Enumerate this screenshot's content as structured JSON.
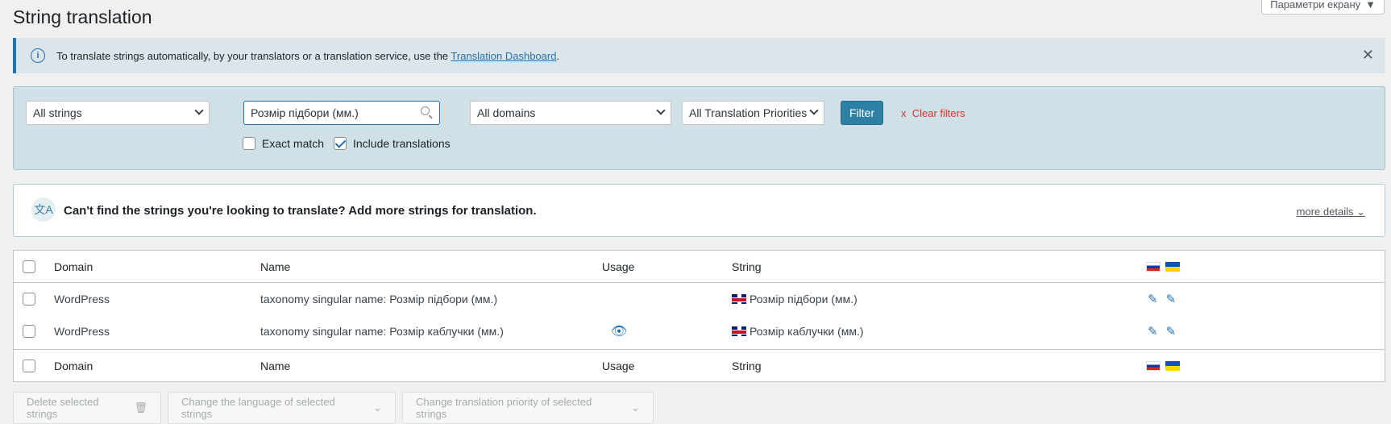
{
  "page": {
    "title": "String translation",
    "screen_options": "Параметри екрану"
  },
  "notice": {
    "text": "To translate strings automatically, by your translators or a translation service, use the ",
    "link": "Translation Dashboard",
    "suffix": "."
  },
  "filters": {
    "strings_select": "All strings",
    "search_value": "Розмір підбори (мм.)",
    "domains_select": "All domains",
    "priorities_select": "All Translation Priorities",
    "filter_button": "Filter",
    "clear_filters": "Clear filters",
    "clear_filters_x": "x",
    "exact_match": {
      "label": "Exact match",
      "checked": false
    },
    "include_translations": {
      "label": "Include translations",
      "checked": true
    }
  },
  "promo": {
    "text": "Can't find the strings you're looking to translate? Add more strings for translation.",
    "more_details": "more details"
  },
  "table": {
    "columns": {
      "domain": "Domain",
      "name": "Name",
      "usage": "Usage",
      "string": "String"
    },
    "rows": [
      {
        "domain": "WordPress",
        "name": "taxonomy singular name: Розмір підбори (мм.)",
        "has_usage": false,
        "string": "Розмір підбори (мм.)"
      },
      {
        "domain": "WordPress",
        "name": "taxonomy singular name: Розмір каблучки (мм.)",
        "has_usage": true,
        "string": "Розмір каблучки (мм.)"
      }
    ]
  },
  "bulk_actions": {
    "delete": "Delete selected strings",
    "change_language": "Change the language of selected strings",
    "change_priority": "Change translation priority of selected strings"
  },
  "icons": {
    "info": "info-icon",
    "close": "close-icon",
    "search": "search-icon",
    "translate": "translate-icon",
    "edit": "pencil-icon",
    "usage": "eye-icon",
    "trash": "trash-icon"
  },
  "colors": {
    "accent": "#2271b1",
    "filter_button": "#2e7fa4",
    "clear_filters": "#d63638",
    "filter_panel": "#cfe0e6",
    "notice_bg": "#dbe5ea"
  }
}
